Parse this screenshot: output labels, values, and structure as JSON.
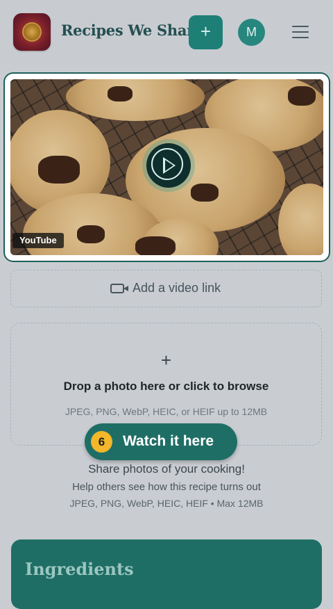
{
  "header": {
    "brand": "Recipes We Share",
    "add_label": "+",
    "avatar_initial": "M"
  },
  "video": {
    "badge": "YouTube"
  },
  "video_link": {
    "label": "Add a video link"
  },
  "dropzone": {
    "plus": "+",
    "title": "Drop a photo here or click to browse",
    "subtitle": "JPEG, PNG, WebP, HEIC, or HEIF up to 12MB"
  },
  "tour": {
    "step": "6",
    "label": "Watch it here"
  },
  "share": {
    "title": "Share photos of your cooking!",
    "subtitle": "Help others see how this recipe turns out",
    "formats": "JPEG, PNG, WebP, HEIC, HEIF • Max 12MB"
  },
  "ingredients": {
    "heading": "Ingredients"
  },
  "colors": {
    "accent": "#1e7f76",
    "badge": "#f2b72a"
  }
}
